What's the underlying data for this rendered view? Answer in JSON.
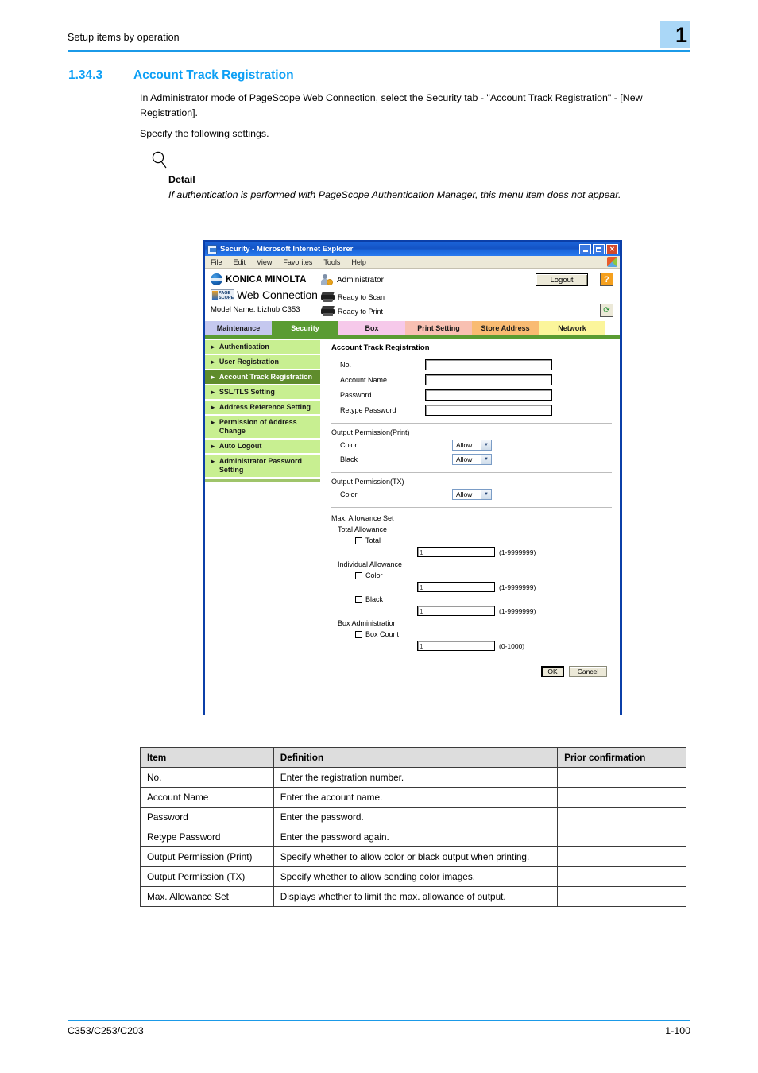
{
  "header": {
    "running_title": "Setup items by operation",
    "chapter_badge": "1"
  },
  "section": {
    "number": "1.34.3",
    "title": "Account Track Registration",
    "paragraph_1": "In Administrator mode of PageScope Web Connection, select the Security tab - \"Account Track Registration\" - [New Registration].",
    "paragraph_2": "Specify the following settings."
  },
  "detail": {
    "label": "Detail",
    "text": "If authentication is performed with PageScope Authentication Manager, this menu item does not appear."
  },
  "browser": {
    "title": "Security - Microsoft Internet Explorer",
    "window_buttons": {
      "minimize": "minimize-icon",
      "maximize": "maximize-icon",
      "close": "✕"
    },
    "menu": [
      "File",
      "Edit",
      "View",
      "Favorites",
      "Tools",
      "Help"
    ]
  },
  "webpage": {
    "brand": "KONICA MINOLTA",
    "product": "Web Connection",
    "pagescope_badge": "PAGE SCOPE",
    "model_name": "Model Name: bizhub C353",
    "status": {
      "admin": "Administrator",
      "scan": "Ready to Scan",
      "print": "Ready to Print"
    },
    "logout_label": "Logout",
    "help_label": "?",
    "refresh_label": "⟳",
    "tabs": [
      {
        "label": "Maintenance",
        "active": false
      },
      {
        "label": "Security",
        "active": true
      },
      {
        "label": "Box",
        "active": false
      },
      {
        "label": "Print Setting",
        "active": false
      },
      {
        "label": "Store Address",
        "active": false
      },
      {
        "label": "Network",
        "active": false
      }
    ],
    "sidebar": [
      {
        "label": "Authentication",
        "active": false
      },
      {
        "label": "User Registration",
        "active": false
      },
      {
        "label": "Account Track Registration",
        "active": true
      },
      {
        "label": "SSL/TLS Setting",
        "active": false
      },
      {
        "label": "Address Reference Setting",
        "active": false
      },
      {
        "label": "Permission of Address Change",
        "active": false
      },
      {
        "label": "Auto Logout",
        "active": false
      },
      {
        "label": "Administrator Password Setting",
        "active": false
      }
    ],
    "form": {
      "title": "Account Track Registration",
      "fields": [
        {
          "label": "No.",
          "value": ""
        },
        {
          "label": "Account Name",
          "value": ""
        },
        {
          "label": "Password",
          "value": ""
        },
        {
          "label": "Retype Password",
          "value": ""
        }
      ],
      "output_permission_print": {
        "group_label": "Output Permission(Print)",
        "rows": [
          {
            "label": "Color",
            "value": "Allow"
          },
          {
            "label": "Black",
            "value": "Allow"
          }
        ]
      },
      "output_permission_tx": {
        "group_label": "Output Permission(TX)",
        "rows": [
          {
            "label": "Color",
            "value": "Allow"
          }
        ]
      },
      "max_allowance": {
        "group_label": "Max. Allowance Set",
        "total_allowance_label": "Total Allowance",
        "total_checkbox": "Total",
        "total_value": "1",
        "total_hint": "(1-9999999)",
        "individual_allowance_label": "Individual Allowance",
        "color_checkbox": "Color",
        "color_value": "1",
        "color_hint": "(1-9999999)",
        "black_checkbox": "Black",
        "black_value": "1",
        "black_hint": "(1-9999999)",
        "box_administration_label": "Box Administration",
        "box_count_checkbox": "Box Count",
        "box_count_value": "1",
        "box_count_hint": "(0-1000)"
      },
      "ok_label": "OK",
      "cancel_label": "Cancel"
    }
  },
  "table": {
    "headers": [
      "Item",
      "Definition",
      "Prior confirmation"
    ],
    "rows": [
      {
        "item": "No.",
        "definition": "Enter the registration number.",
        "prior": ""
      },
      {
        "item": "Account Name",
        "definition": "Enter the account name.",
        "prior": ""
      },
      {
        "item": "Password",
        "definition": "Enter the password.",
        "prior": ""
      },
      {
        "item": "Retype Password",
        "definition": "Enter the password again.",
        "prior": ""
      },
      {
        "item": "Output Permission (Print)",
        "definition": "Specify whether to allow color or black output when printing.",
        "prior": ""
      },
      {
        "item": "Output Permission (TX)",
        "definition": "Specify whether to allow sending color images.",
        "prior": ""
      },
      {
        "item": "Max. Allowance Set",
        "definition": "Displays whether to limit the max. allowance of output.",
        "prior": ""
      }
    ]
  },
  "footer": {
    "left": "C353/C253/C203",
    "right": "1-100"
  },
  "colors": {
    "accent_blue": "#1b9ae8",
    "heading_blue": "#0d9ff5",
    "badge_blue": "#aad7f7",
    "tab_active_green": "#5a9c32",
    "sidebar_green": "#c8ef91",
    "sidebar_active_green": "#5f8c2c"
  }
}
